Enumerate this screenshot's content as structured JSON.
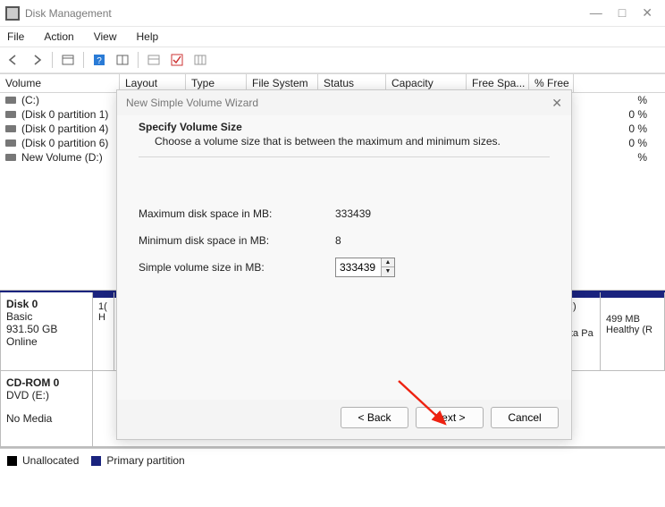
{
  "window": {
    "title": "Disk Management",
    "min_icon": "—",
    "max_icon": "□",
    "close_icon": "✕"
  },
  "menubar": {
    "file": "File",
    "action": "Action",
    "view": "View",
    "help": "Help"
  },
  "columns": {
    "volume": "Volume",
    "layout": "Layout",
    "type": "Type",
    "filesystem": "File System",
    "status": "Status",
    "capacity": "Capacity",
    "freespace": "Free Spa...",
    "pctfree": "% Free"
  },
  "volumes": [
    {
      "name": "(C:)",
      "pct": "%"
    },
    {
      "name": "(Disk 0 partition 1)",
      "pct": "0 %"
    },
    {
      "name": "(Disk 0 partition 4)",
      "pct": "0 %"
    },
    {
      "name": "(Disk 0 partition 6)",
      "pct": "0 %"
    },
    {
      "name": "New Volume (D:)",
      "pct": "%"
    }
  ],
  "disks": {
    "d0": {
      "title": "Disk 0",
      "type": "Basic",
      "size": "931.50 GB",
      "status": "Online",
      "slot0": "1(",
      "slot0b": "H",
      "slot_last_label": ":)",
      "slot_last_sub": "ta Pa",
      "slot_r_size": "499 MB",
      "slot_r_status": "Healthy (R"
    },
    "cd": {
      "title": "CD-ROM 0",
      "drive": "DVD (E:)",
      "status": "No Media"
    }
  },
  "legend": {
    "unalloc": "Unallocated",
    "primary": "Primary partition"
  },
  "dialog": {
    "title": "New Simple Volume Wizard",
    "heading": "Specify Volume Size",
    "sub": "Choose a volume size that is between the maximum and minimum sizes.",
    "max_label": "Maximum disk space in MB:",
    "max_value": "333439",
    "min_label": "Minimum disk space in MB:",
    "min_value": "8",
    "size_label": "Simple volume size in MB:",
    "size_value": "333439",
    "back": "< Back",
    "next": "Next >",
    "cancel": "Cancel"
  }
}
